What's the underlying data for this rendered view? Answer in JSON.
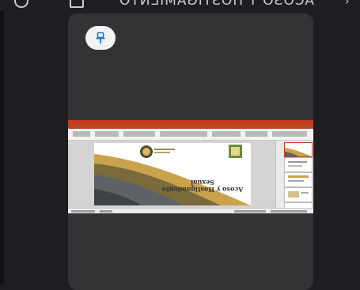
{
  "header": {
    "title": "ACOSO Y HOSTIGAMIENTO",
    "back_icon": "back-arrow-icon",
    "doc_icon": "document-icon",
    "more_icon": "more-icon"
  },
  "pin": {
    "icon": "pin-icon",
    "accent": "#1f72d6"
  },
  "screenshot": {
    "app": "PowerPoint",
    "accent": "#c43e1c",
    "slide_title_line1": "Acoso y Hostigamiento",
    "slide_title_line2": "Sexual",
    "thumbnail_count": 5
  }
}
